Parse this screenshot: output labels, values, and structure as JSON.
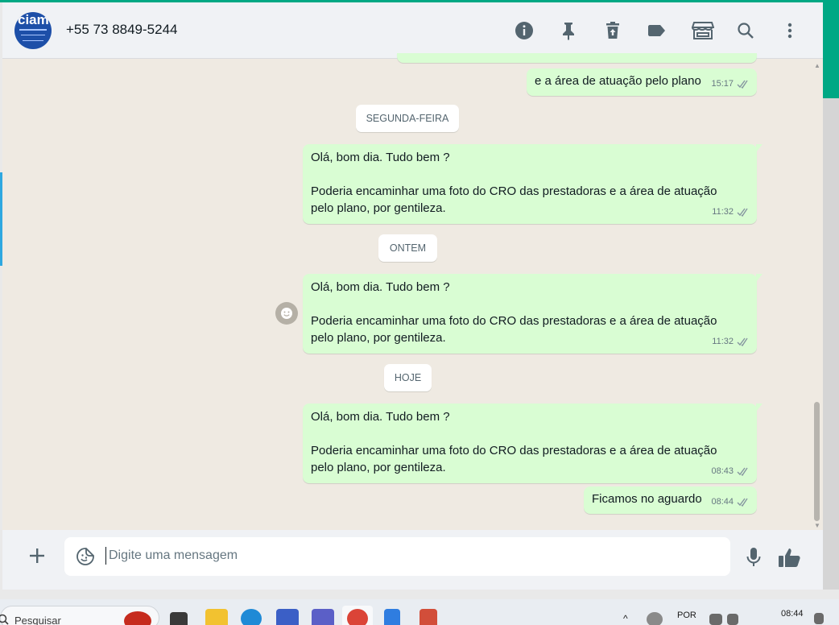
{
  "header": {
    "avatar_text": "ciam",
    "contact_name": "+55 73 8849-5244",
    "icons": [
      "info-icon",
      "pin-icon",
      "delete-icon",
      "label-icon",
      "catalog-icon",
      "search-icon",
      "menu-icon"
    ]
  },
  "messages": [
    {
      "text": "e a área de atuação pelo plano",
      "time": "15:17",
      "status": "read"
    },
    {
      "text": "Olá, bom dia. Tudo bem ?\n\nPoderia encaminhar uma foto do CRO das prestadoras e a área de atuação\npelo plano, por gentileza.",
      "time": "11:32",
      "status": "read"
    },
    {
      "text": "Olá, bom dia. Tudo bem ?\n\nPoderia encaminhar uma foto do CRO das prestadoras e a área de atuação\npelo plano, por gentileza.",
      "time": "11:32",
      "status": "read"
    },
    {
      "text": "Olá, bom dia. Tudo bem ?\n\nPoderia encaminhar uma foto do CRO das prestadoras e a área de atuação\npelo plano, por gentileza.",
      "time": "08:43",
      "status": "read"
    },
    {
      "text": "Ficamos no aguardo",
      "time": "08:44",
      "status": "read"
    }
  ],
  "dates": [
    "SEGUNDA-FEIRA",
    "ONTEM",
    "HOJE"
  ],
  "composer": {
    "placeholder": "Digite uma mensagem"
  },
  "taskbar": {
    "search_label": "Pesquisar",
    "language": "POR",
    "time": "08:44"
  },
  "colors": {
    "accent": "#00a884",
    "outgoing_bubble": "#d9fdd3",
    "chat_background": "#efeae2",
    "read_ticks": "#8696a0"
  }
}
